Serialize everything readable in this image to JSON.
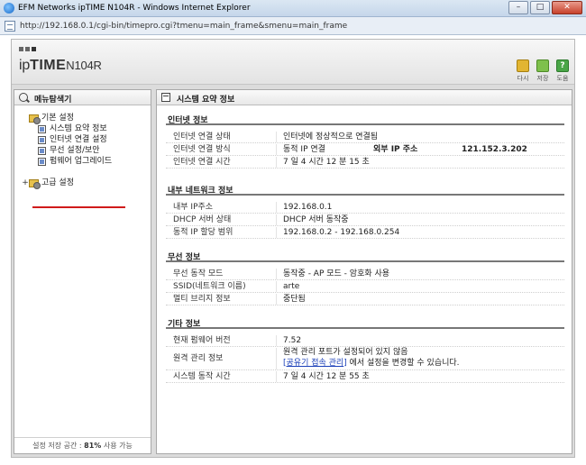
{
  "window": {
    "title": "EFM Networks ipTIME N104R - Windows Internet Explorer",
    "url": "http://192.168.0.1/cgi-bin/timepro.cgi?tmenu=main_frame&smenu=main_frame"
  },
  "header": {
    "brand_prefix": "ip",
    "brand_main": "TIME",
    "brand_model": "N104R",
    "buttons": {
      "refresh": "다시",
      "save": "저장",
      "help": "도움"
    }
  },
  "sidebar": {
    "title": "메뉴탐색기",
    "root_basic": "기본 설정",
    "items": [
      {
        "label": "시스템 요약 정보"
      },
      {
        "label": "인터넷 연결 설정"
      },
      {
        "label": "무선 설정/보안"
      },
      {
        "label": "펌웨어 업그레이드"
      }
    ],
    "root_advanced": "고급 설정",
    "storage_prefix": "설정 저장 공간 : ",
    "storage_value": "81%",
    "storage_suffix": " 사용 가능"
  },
  "main": {
    "title": "시스템 요약 정보",
    "sections": {
      "internet": {
        "title": "인터넷 정보",
        "rows": [
          {
            "k": "인터넷 연결 상태",
            "v": "인터넷에 정상적으로 연결됨"
          },
          {
            "k": "인터넷 연결 방식",
            "v": "동적 IP 연결",
            "k2": "외부 IP 주소",
            "v2": "121.152.3.202"
          },
          {
            "k": "인터넷 연결 시간",
            "v": "7 일 4 시간 12 분 15 초"
          }
        ]
      },
      "lan": {
        "title": "내부 네트워크 정보",
        "rows": [
          {
            "k": "내부 IP주소",
            "v": "192.168.0.1"
          },
          {
            "k": "DHCP 서버 상태",
            "v": "DHCP 서버 동작중"
          },
          {
            "k": "동적 IP 할당 범위",
            "v": "192.168.0.2 -  192.168.0.254"
          }
        ]
      },
      "wireless": {
        "title": "무선 정보",
        "rows": [
          {
            "k": "무선 동작 모드",
            "v": "동작중 - AP 모드 - 암호화 사용"
          },
          {
            "k": "SSID(네트워크 이름)",
            "v": "arte"
          },
          {
            "k": "멀티 브리지 정보",
            "v": "중단됨"
          }
        ]
      },
      "other": {
        "title": "기타 정보",
        "firmware": {
          "k": "현재 펌웨어 버전",
          "v": "7.52"
        },
        "remote": {
          "k": "원격 관리 정보",
          "line1": "원격 관리 포트가 설정되어 있지 않음",
          "bracket_open": "[",
          "link": "공유기 접속 관리",
          "bracket_close": "]",
          "line2_suffix": " 에서 설정을 변경할 수 있습니다."
        },
        "uptime": {
          "k": "시스템 동작 시간",
          "v": "7 일 4 시간 12 분 55 초"
        }
      }
    }
  }
}
